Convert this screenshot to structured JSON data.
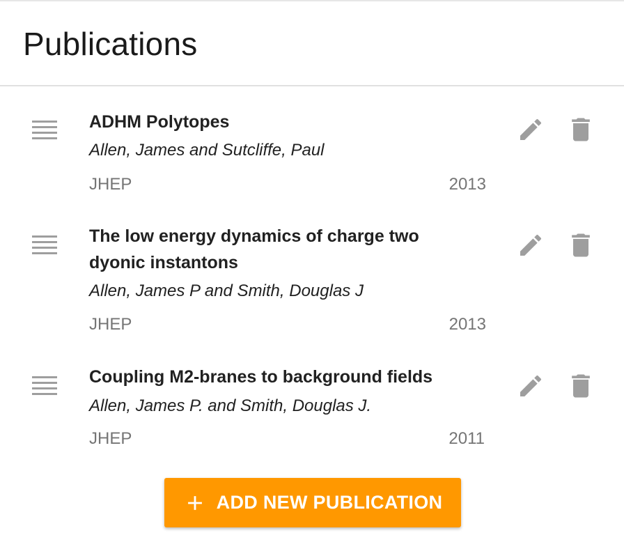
{
  "page": {
    "title": "Publications"
  },
  "colors": {
    "accent": "#ff9800",
    "icon": "#9e9e9e",
    "muted_text": "#757575"
  },
  "publications": [
    {
      "title": "ADHM Polytopes",
      "authors": "Allen, James and Sutcliffe, Paul",
      "journal": "JHEP",
      "year": "2013"
    },
    {
      "title": "The low energy dynamics of charge two dyonic instantons",
      "authors": "Allen, James P and Smith, Douglas J",
      "journal": "JHEP",
      "year": "2013"
    },
    {
      "title": "Coupling M2-branes to background fields",
      "authors": "Allen, James P. and Smith, Douglas J.",
      "journal": "JHEP",
      "year": "2011"
    }
  ],
  "icons": {
    "drag": "drag-handle-icon",
    "edit": "pencil-icon",
    "delete": "trash-icon",
    "add": "plus-icon"
  },
  "actions": {
    "add_label": "ADD NEW PUBLICATION"
  }
}
